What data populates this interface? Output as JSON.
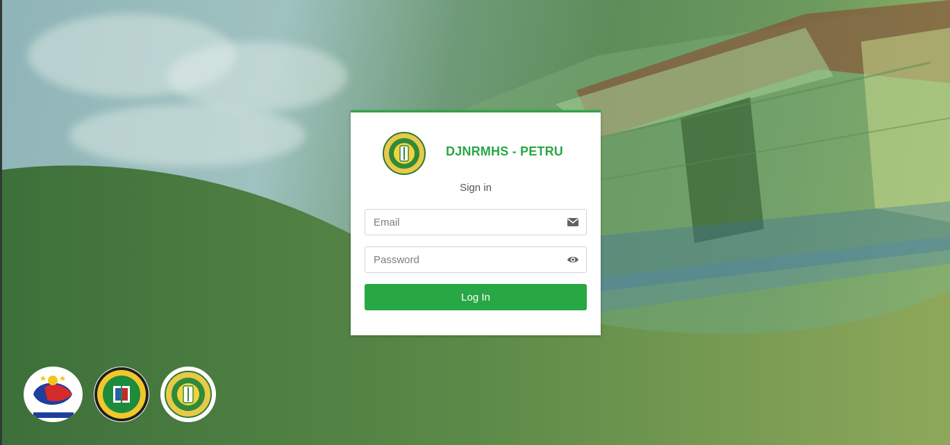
{
  "brand": {
    "title": "DJNRMHS - PETRU",
    "logo_icon": "petru-seal-logo"
  },
  "form": {
    "heading": "Sign in",
    "email": {
      "placeholder": "Email",
      "value": "",
      "icon": "envelope-icon"
    },
    "password": {
      "placeholder": "Password",
      "value": "",
      "icon": "eye-icon"
    },
    "submit_label": "Log In"
  },
  "footer_logos": [
    {
      "name": "bagong-pilipinas-logo"
    },
    {
      "name": "department-of-health-seal"
    },
    {
      "name": "petru-seal-logo"
    }
  ],
  "colors": {
    "accent": "#28a745",
    "wave_dark": "#3d6f3a",
    "wave_light": "#8ea85a"
  }
}
